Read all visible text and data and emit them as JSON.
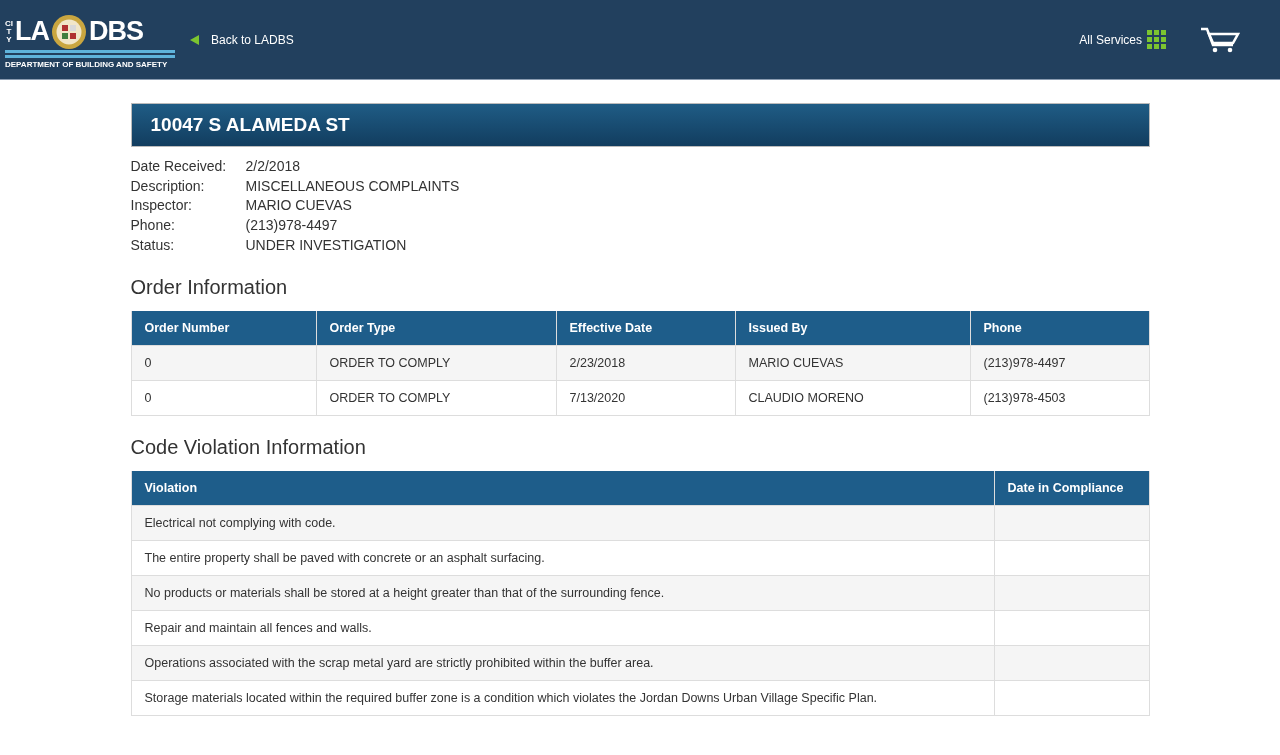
{
  "header": {
    "logo": {
      "city": "CITY",
      "left": "LA",
      "right": "DBS",
      "subtitle": "DEPARTMENT OF BUILDING AND SAFETY"
    },
    "back_link": "Back to LADBS",
    "all_services": "All Services"
  },
  "title": "10047 S ALAMEDA ST",
  "details": [
    {
      "label": "Date Received:",
      "value": "2/2/2018"
    },
    {
      "label": "Description:",
      "value": "MISCELLANEOUS COMPLAINTS"
    },
    {
      "label": "Inspector:",
      "value": "MARIO CUEVAS"
    },
    {
      "label": "Phone:",
      "value": "(213)978-4497"
    },
    {
      "label": "Status:",
      "value": "UNDER INVESTIGATION"
    }
  ],
  "order_section": {
    "heading": "Order Information",
    "columns": [
      "Order Number",
      "Order Type",
      "Effective Date",
      "Issued By",
      "Phone"
    ],
    "rows": [
      [
        "0",
        "ORDER TO COMPLY",
        "2/23/2018",
        "MARIO CUEVAS",
        "(213)978-4497"
      ],
      [
        "0",
        "ORDER TO COMPLY",
        "7/13/2020",
        "CLAUDIO MORENO",
        "(213)978-4503"
      ]
    ]
  },
  "violation_section": {
    "heading": "Code Violation Information",
    "columns": [
      "Violation",
      "Date in Compliance"
    ],
    "rows": [
      [
        "Electrical not complying with code."
      ],
      [
        "The entire property shall be paved with concrete or an asphalt surfacing."
      ],
      [
        "No products or materials shall be stored at a height greater than that of the surrounding fence."
      ],
      [
        "Repair and maintain all fences and walls."
      ],
      [
        "Operations associated with the scrap metal yard are strictly prohibited within the buffer area."
      ],
      [
        "Storage materials located within the required buffer zone is a condition which violates the Jordan Downs Urban Village Specific Plan."
      ]
    ]
  }
}
